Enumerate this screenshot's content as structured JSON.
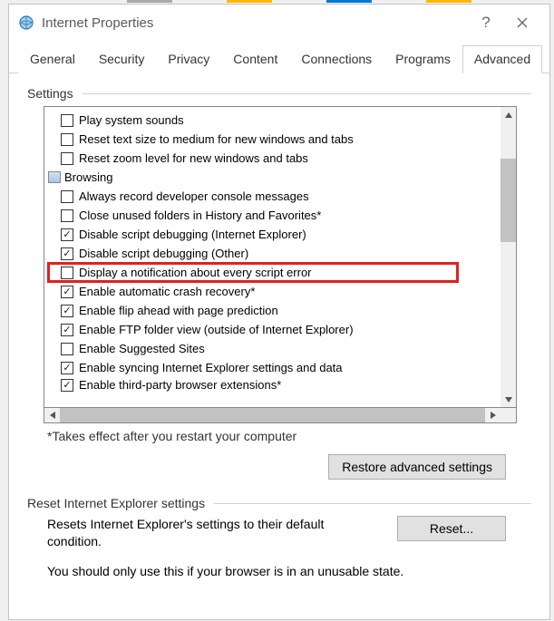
{
  "window": {
    "title": "Internet Properties"
  },
  "tabs": [
    {
      "label": "General"
    },
    {
      "label": "Security"
    },
    {
      "label": "Privacy"
    },
    {
      "label": "Content"
    },
    {
      "label": "Connections"
    },
    {
      "label": "Programs"
    },
    {
      "label": "Advanced"
    }
  ],
  "settings_label": "Settings",
  "items": [
    {
      "type": "check",
      "checked": false,
      "label": "Play system sounds"
    },
    {
      "type": "check",
      "checked": false,
      "label": "Reset text size to medium for new windows and tabs"
    },
    {
      "type": "check",
      "checked": false,
      "label": "Reset zoom level for new windows and tabs"
    },
    {
      "type": "category",
      "label": "Browsing"
    },
    {
      "type": "check",
      "checked": false,
      "label": "Always record developer console messages"
    },
    {
      "type": "check",
      "checked": false,
      "label": "Close unused folders in History and Favorites*"
    },
    {
      "type": "check",
      "checked": true,
      "label": "Disable script debugging (Internet Explorer)"
    },
    {
      "type": "check",
      "checked": true,
      "label": "Disable script debugging (Other)"
    },
    {
      "type": "check",
      "checked": false,
      "highlight": true,
      "label": "Display a notification about every script error"
    },
    {
      "type": "check",
      "checked": true,
      "label": "Enable automatic crash recovery*"
    },
    {
      "type": "check",
      "checked": true,
      "label": "Enable flip ahead with page prediction"
    },
    {
      "type": "check",
      "checked": true,
      "label": "Enable FTP folder view (outside of Internet Explorer)"
    },
    {
      "type": "check",
      "checked": false,
      "label": "Enable Suggested Sites"
    },
    {
      "type": "check",
      "checked": true,
      "label": "Enable syncing Internet Explorer settings and data"
    },
    {
      "type": "check",
      "checked": true,
      "label": "Enable third-party browser extensions*"
    }
  ],
  "restart_note": "*Takes effect after you restart your computer",
  "restore_btn": "Restore advanced settings",
  "reset_label": "Reset Internet Explorer settings",
  "reset_desc": "Resets Internet Explorer's settings to their default condition.",
  "reset_btn": "Reset...",
  "reset_warn": "You should only use this if your browser is in an unusable state."
}
